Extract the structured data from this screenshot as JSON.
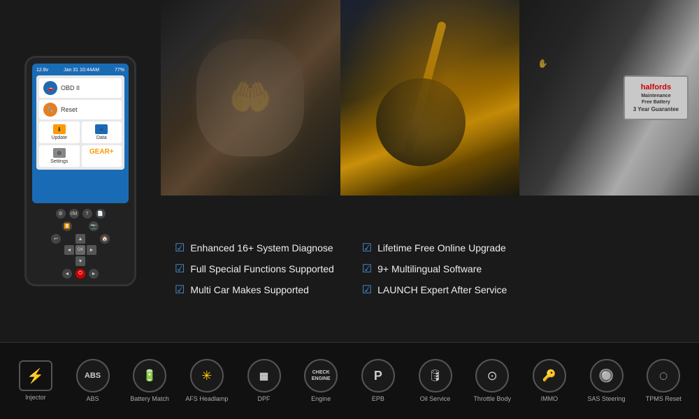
{
  "device": {
    "status_bar": {
      "signal": "12.8v",
      "time": "Jan 31 10:44AM",
      "battery": "77%"
    },
    "menu_items": [
      {
        "label": "OBD II",
        "icon": "🚗"
      },
      {
        "label": "Reset",
        "icon": "🔧"
      }
    ],
    "grid_items": [
      {
        "label": "Update",
        "icon_type": "orange"
      },
      {
        "label": "Data",
        "icon_type": "blue"
      },
      {
        "label": "Settings",
        "icon_type": "gear"
      },
      {
        "label": "GEAR+",
        "icon_type": "gear-text"
      }
    ]
  },
  "features": {
    "left_column": [
      "Enhanced 16+ System Diagnose",
      "Full Special Functions Supported",
      "Multi Car Makes Supported"
    ],
    "right_column": [
      "Lifetime Free Online Upgrade",
      "9+ Multilingual Software",
      "LAUNCH Expert After Service"
    ]
  },
  "bottom_icons": [
    {
      "label": "Injector",
      "icon": "⚡",
      "circle": false
    },
    {
      "label": "ABS",
      "icon": "ABS",
      "circle": true
    },
    {
      "label": "Battery Match",
      "icon": "🔋",
      "circle": true
    },
    {
      "label": "AFS Headlamp",
      "icon": "✳",
      "circle": true
    },
    {
      "label": "DPF",
      "icon": "▦",
      "circle": true
    },
    {
      "label": "Engine",
      "icon": "CHECK\nENGINE",
      "circle": true
    },
    {
      "label": "EPB",
      "icon": "P",
      "circle": true
    },
    {
      "label": "Oil Service",
      "icon": "🛢",
      "circle": true
    },
    {
      "label": "Throttle Body",
      "icon": "⊙",
      "circle": true
    },
    {
      "label": "IMMO",
      "icon": "🔑",
      "circle": true
    },
    {
      "label": "SAS Steering",
      "icon": "🔘",
      "circle": true
    },
    {
      "label": "TPMS Reset",
      "icon": "◌",
      "circle": true
    }
  ],
  "colors": {
    "background": "#111111",
    "accent_blue": "#1a6bb5",
    "check_color": "#4a90d9",
    "text_primary": "#eeeeee",
    "text_secondary": "#aaaaaa",
    "border": "#555555"
  }
}
